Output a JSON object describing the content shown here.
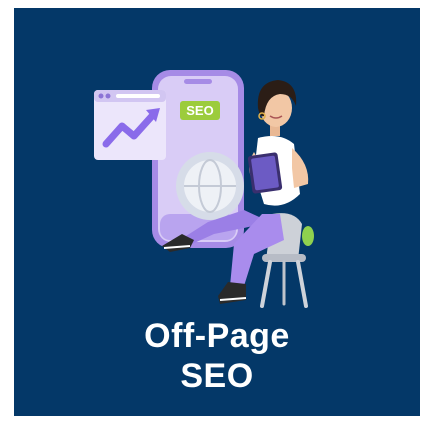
{
  "card": {
    "background": "#043868",
    "title_line1": "Off-Page",
    "title_line2": "SEO"
  },
  "illustration": {
    "badge_label": "SEO",
    "badge_color": "#9ccc3c",
    "icons": [
      "phone-icon",
      "browser-window-icon",
      "trend-arrow-icon",
      "globe-icon",
      "tablet-icon"
    ]
  }
}
